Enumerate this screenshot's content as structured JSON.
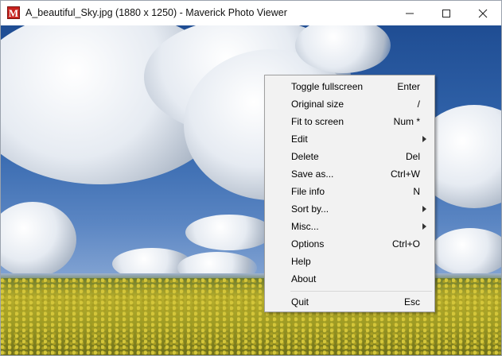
{
  "window": {
    "title": "A_beautiful_Sky.jpg  (1880 x 1250) - Maverick Photo Viewer",
    "app_icon_letter": "M",
    "controls": [
      "minimize-icon",
      "maximize-icon",
      "close-icon"
    ]
  },
  "colors": {
    "menu_background": "#f2f2f2",
    "menu_border": "#a0a0a0",
    "app_icon": "#c8231f",
    "sky": "#3366ad",
    "field": "#b7ae2c"
  },
  "context_menu": {
    "items": [
      {
        "label": "Toggle fullscreen",
        "shortcut": "Enter"
      },
      {
        "label": "Original size",
        "shortcut": "/"
      },
      {
        "label": "Fit to screen",
        "shortcut": "Num *"
      },
      {
        "label": "Edit",
        "shortcut": "",
        "submenu": true
      },
      {
        "label": "Delete",
        "shortcut": "Del"
      },
      {
        "label": "Save as...",
        "shortcut": "Ctrl+W"
      },
      {
        "label": "File info",
        "shortcut": "N"
      },
      {
        "label": "Sort by...",
        "shortcut": "",
        "submenu": true
      },
      {
        "label": "Misc...",
        "shortcut": "",
        "submenu": true
      },
      {
        "label": "Options",
        "shortcut": "Ctrl+O"
      },
      {
        "label": "Help",
        "shortcut": ""
      },
      {
        "label": "About",
        "shortcut": ""
      },
      {
        "label": "Quit",
        "shortcut": "Esc"
      }
    ]
  }
}
